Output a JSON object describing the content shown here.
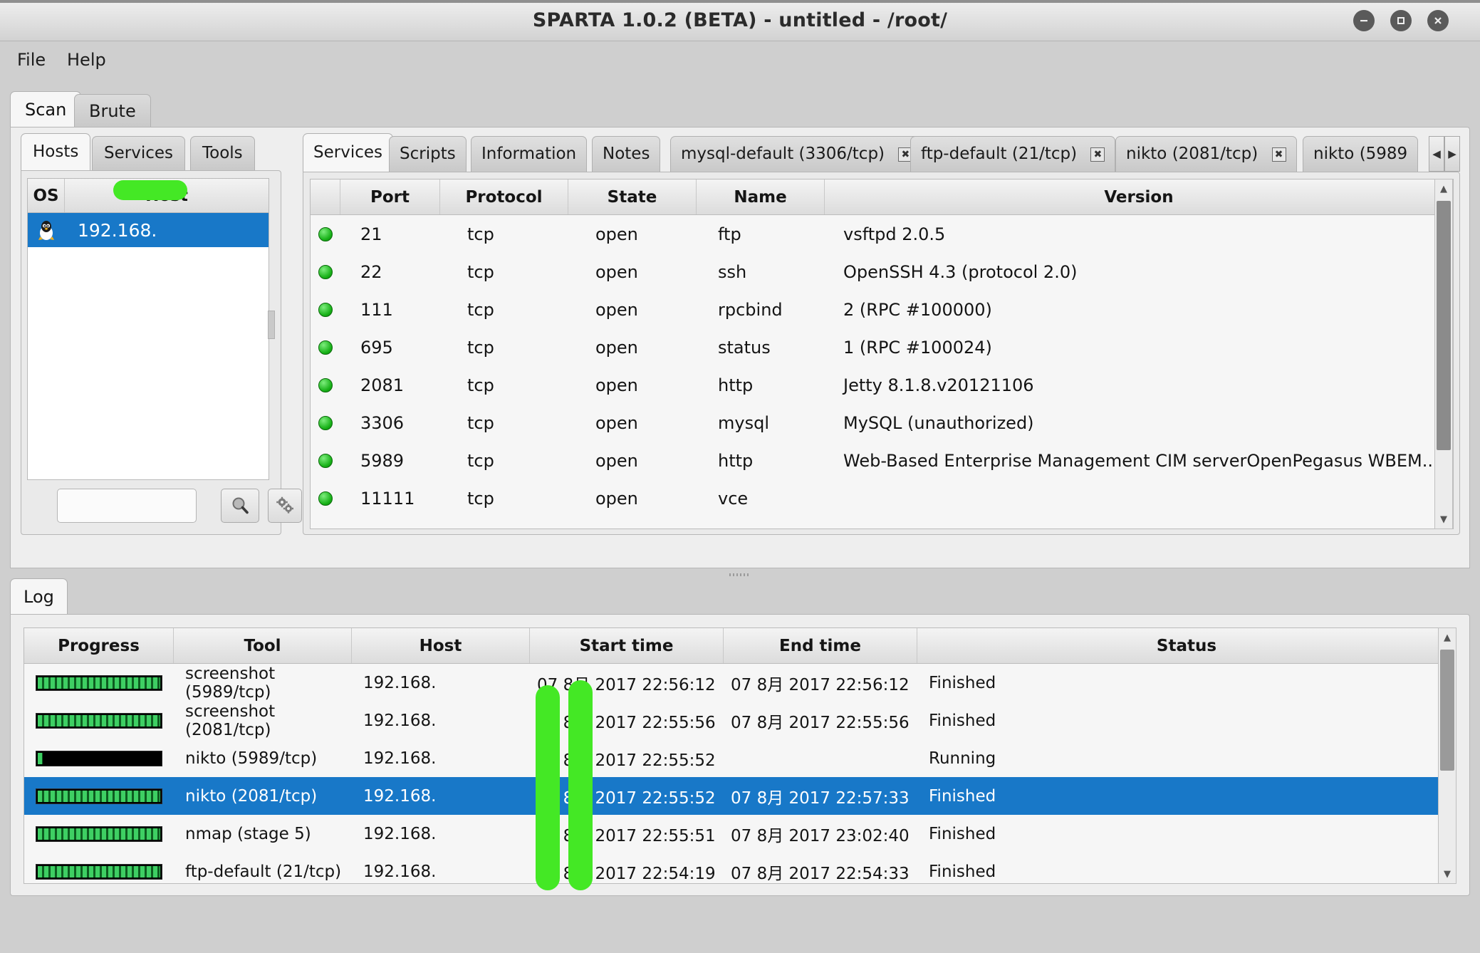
{
  "window": {
    "title": "SPARTA 1.0.2 (BETA) - untitled - /root/",
    "buttons": {
      "minimize": "minimize-button",
      "maximize": "maximize-button",
      "close": "close-button"
    }
  },
  "menubar": {
    "items": [
      "File",
      "Help"
    ]
  },
  "top_tabs": [
    {
      "label": "Scan",
      "active": true
    },
    {
      "label": "Brute",
      "active": false
    }
  ],
  "left_panel": {
    "tabs": [
      {
        "label": "Hosts",
        "active": true
      },
      {
        "label": "Services",
        "active": false
      },
      {
        "label": "Tools",
        "active": false
      }
    ],
    "hosts_table": {
      "columns": [
        "OS",
        "Host"
      ],
      "rows": [
        {
          "os_icon": "linux-penguin-icon",
          "host": "192.168.",
          "redacted": true,
          "selected": true
        }
      ]
    },
    "search": {
      "value": "",
      "placeholder": ""
    },
    "buttons": [
      {
        "name": "search-button",
        "icon": "magnifier-icon"
      },
      {
        "name": "tool-settings-button",
        "icon": "gears-icon"
      }
    ]
  },
  "right_panel": {
    "tabs": [
      {
        "label": "Services",
        "active": true,
        "closable": false
      },
      {
        "label": "Scripts",
        "active": false,
        "closable": false
      },
      {
        "label": "Information",
        "active": false,
        "closable": false
      },
      {
        "label": "Notes",
        "active": false,
        "closable": false
      },
      {
        "label": "mysql-default (3306/tcp)",
        "active": false,
        "closable": true
      },
      {
        "label": "ftp-default (21/tcp)",
        "active": false,
        "closable": true
      },
      {
        "label": "nikto (2081/tcp)",
        "active": false,
        "closable": true
      },
      {
        "label": "nikto (5989",
        "active": false,
        "closable": false
      }
    ],
    "tab_scroll": {
      "left": "◀",
      "right": "▶"
    },
    "services_table": {
      "columns": [
        "",
        "Port",
        "Protocol",
        "State",
        "Name",
        "Version"
      ],
      "rows": [
        {
          "status": "open-dot",
          "port": "21",
          "protocol": "tcp",
          "state": "open",
          "name": "ftp",
          "version": "vsftpd 2.0.5"
        },
        {
          "status": "open-dot",
          "port": "22",
          "protocol": "tcp",
          "state": "open",
          "name": "ssh",
          "version": "OpenSSH 4.3 (protocol 2.0)"
        },
        {
          "status": "open-dot",
          "port": "111",
          "protocol": "tcp",
          "state": "open",
          "name": "rpcbind",
          "version": "2 (RPC #100000)"
        },
        {
          "status": "open-dot",
          "port": "695",
          "protocol": "tcp",
          "state": "open",
          "name": "status",
          "version": "1 (RPC #100024)"
        },
        {
          "status": "open-dot",
          "port": "2081",
          "protocol": "tcp",
          "state": "open",
          "name": "http",
          "version": "Jetty 8.1.8.v20121106"
        },
        {
          "status": "open-dot",
          "port": "3306",
          "protocol": "tcp",
          "state": "open",
          "name": "mysql",
          "version": "MySQL (unauthorized)"
        },
        {
          "status": "open-dot",
          "port": "5989",
          "protocol": "tcp",
          "state": "open",
          "name": "http",
          "version": "Web-Based Enterprise Management CIM serverOpenPegasus WBEM..."
        },
        {
          "status": "open-dot",
          "port": "11111",
          "protocol": "tcp",
          "state": "open",
          "name": "vce",
          "version": ""
        }
      ]
    }
  },
  "log_panel": {
    "tab": {
      "label": "Log",
      "active": true
    },
    "columns": [
      "Progress",
      "Tool",
      "Host",
      "Start time",
      "End time",
      "Status"
    ],
    "rows": [
      {
        "progress": 100,
        "tool": "screenshot (5989/tcp)",
        "host": "192.168.",
        "start": "07 8月 2017 22:56:12",
        "end": "07 8月 2017 22:56:12",
        "status": "Finished",
        "selected": false
      },
      {
        "progress": 100,
        "tool": "screenshot (2081/tcp)",
        "host": "192.168.",
        "start": "07 8月 2017 22:55:56",
        "end": "07 8月 2017 22:55:56",
        "status": "Finished",
        "selected": false
      },
      {
        "progress": 4,
        "tool": "nikto (5989/tcp)",
        "host": "192.168.",
        "start": "07 8月 2017 22:55:52",
        "end": "",
        "status": "Running",
        "selected": false
      },
      {
        "progress": 100,
        "tool": "nikto (2081/tcp)",
        "host": "192.168.",
        "start": "07 8月 2017 22:55:52",
        "end": "07 8月 2017 22:57:33",
        "status": "Finished",
        "selected": true
      },
      {
        "progress": 100,
        "tool": "nmap (stage 5)",
        "host": "192.168.",
        "start": "07 8月 2017 22:55:51",
        "end": "07 8月 2017 23:02:40",
        "status": "Finished",
        "selected": false
      },
      {
        "progress": 100,
        "tool": "ftp-default (21/tcp)",
        "host": "192.168.",
        "start": "07 8月 2017 22:54:19",
        "end": "07 8月 2017 22:54:33",
        "status": "Finished",
        "selected": false
      }
    ]
  },
  "colors": {
    "selection_blue": "#1878c8",
    "redaction_green": "#44e825",
    "open_status_green": "#17b117",
    "window_bg": "#cfcfcf",
    "panel_bg": "#eeeeee",
    "table_bg": "#f6f6f6"
  }
}
